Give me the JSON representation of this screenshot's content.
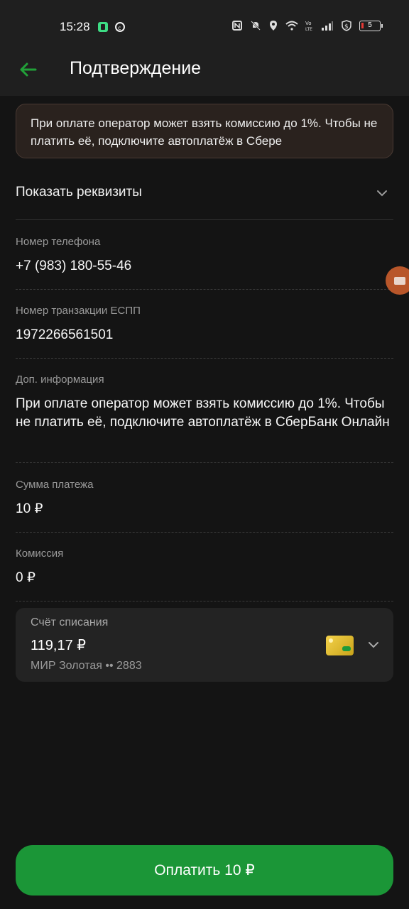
{
  "status_bar": {
    "time": "15:28",
    "battery": "5"
  },
  "app_bar": {
    "title": "Подтверждение"
  },
  "notice": {
    "text": "При оплате оператор может взять комиссию до 1%. Чтобы не платить её, подключите автоплатёж в Сбере"
  },
  "details_toggle": {
    "label": "Показать реквизиты"
  },
  "fields": [
    {
      "label": "Номер телефона",
      "value": "+7 (983) 180-55-46"
    },
    {
      "label": "Номер транзакции ЕСПП",
      "value": "1972266561501"
    },
    {
      "label": "Доп. информация",
      "value": "При оплате оператор может взять комиссию до 1%. Чтобы не платить её, подключите автоплатёж в СберБанк Онлайн"
    },
    {
      "label": "Сумма платежа",
      "value": "10 ₽"
    },
    {
      "label": "Комиссия",
      "value": "0 ₽"
    }
  ],
  "account": {
    "label": "Счёт списания",
    "balance": "119,17 ₽",
    "card": "МИР Золотая •• 2883"
  },
  "pay_button": {
    "label": "Оплатить 10 ₽"
  },
  "colors": {
    "accent": "#1b9637",
    "background": "#141414",
    "notice_bg": "#2a221e"
  }
}
